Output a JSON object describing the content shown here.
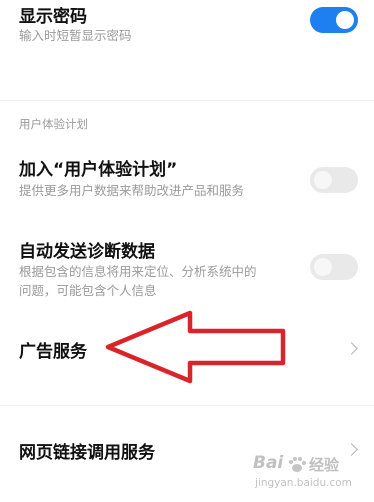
{
  "show_password": {
    "title": "显示密码",
    "subtitle": "输入时短暂显示密码",
    "enabled": true
  },
  "section_header": "用户体验计划",
  "join_ux": {
    "title": "加入“用户体验计划”",
    "subtitle": "提供更多用户数据来帮助改进产品和服务",
    "enabled": false
  },
  "diagnostics": {
    "title": "自动发送诊断数据",
    "subtitle_line1": "根据包含的信息将用来定位、分析系统中的",
    "subtitle_line2": "问题，可能包含个人信息",
    "enabled": false
  },
  "ad_service": {
    "title": "广告服务"
  },
  "web_link_service": {
    "title": "网页链接调用服务"
  },
  "watermark": {
    "logo_text": "Bai",
    "logo_text2": "经验",
    "url": "jingyan.baidu.com"
  },
  "colors": {
    "toggle_on": "#1e7ff0",
    "toggle_off": "#e9e9e9",
    "annotation_arrow": "#d9252a"
  },
  "icons": [
    "chevron-right-icon",
    "paw-icon",
    "red-arrow-annotation"
  ]
}
